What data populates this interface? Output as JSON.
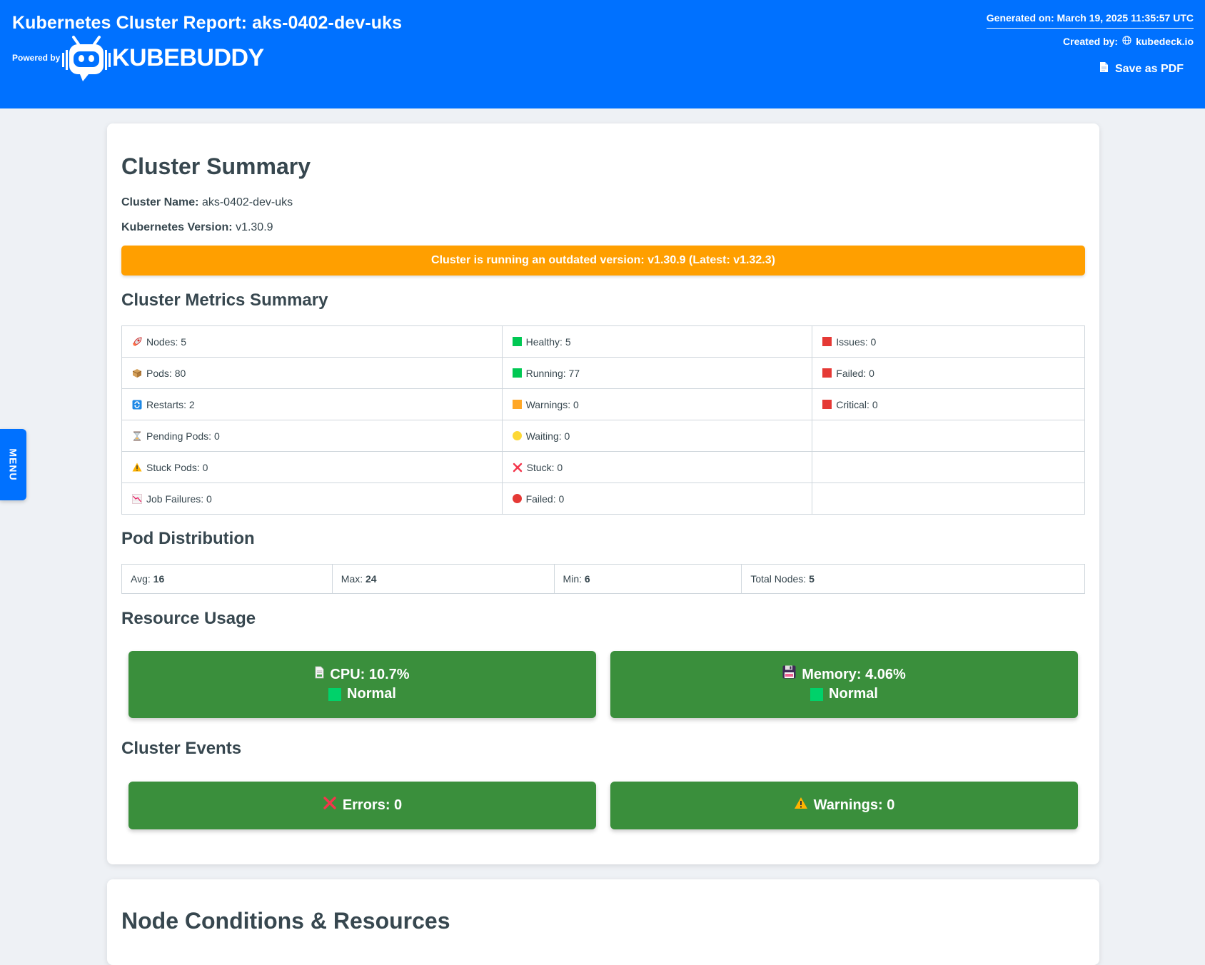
{
  "header": {
    "title": "Kubernetes Cluster Report: aks-0402-dev-uks",
    "powered_by": "Powered by",
    "logo_text": "KUBEBUDDY",
    "generated_on": "Generated on: March 19, 2025 11:35:57 UTC",
    "created_by_label": "Created by:",
    "created_by_value": "kubedeck.io",
    "save_pdf": "Save as PDF"
  },
  "menu": {
    "label": "MENU"
  },
  "summary": {
    "title": "Cluster Summary",
    "cluster_name_label": "Cluster Name:",
    "cluster_name": "aks-0402-dev-uks",
    "k8s_version_label": "Kubernetes Version:",
    "k8s_version": "v1.30.9",
    "alert": "Cluster is running an outdated version: v1.30.9 (Latest: v1.32.3)",
    "alert_color": "#ff9f00"
  },
  "metrics": {
    "title": "Cluster Metrics Summary",
    "rows": [
      {
        "a": "Nodes: 5",
        "a_icon": "rocket-icon",
        "b": "Healthy: 5",
        "b_icon": "green-square-icon",
        "c": "Issues: 0",
        "c_icon": "red-square-icon"
      },
      {
        "a": "Pods: 80",
        "a_icon": "package-icon",
        "b": "Running: 77",
        "b_icon": "green-square-icon",
        "c": "Failed: 0",
        "c_icon": "red-square-icon"
      },
      {
        "a": "Restarts: 2",
        "a_icon": "refresh-icon",
        "b": "Warnings: 0",
        "b_icon": "orange-square-icon",
        "c": "Critical: 0",
        "c_icon": "red-square-icon"
      },
      {
        "a": "Pending Pods: 0",
        "a_icon": "hourglass-icon",
        "b": "Waiting: 0",
        "b_icon": "yellow-circle-icon",
        "c": ""
      },
      {
        "a": "Stuck Pods: 0",
        "a_icon": "warning-icon",
        "b": "Stuck: 0",
        "b_icon": "cross-icon",
        "c": ""
      },
      {
        "a": "Job Failures: 0",
        "a_icon": "chart-down-icon",
        "b": "Failed: 0",
        "b_icon": "red-circle-icon",
        "c": ""
      }
    ]
  },
  "distribution": {
    "title": "Pod Distribution",
    "items": [
      {
        "label": "Avg:",
        "value": "16"
      },
      {
        "label": "Max:",
        "value": "24"
      },
      {
        "label": "Min:",
        "value": "6"
      },
      {
        "label": "Total Nodes:",
        "value": "5"
      }
    ]
  },
  "resources": {
    "title": "Resource Usage",
    "cpu": {
      "label": "CPU: 10.7%",
      "status": "Normal",
      "icon": "page-icon"
    },
    "memory": {
      "label": "Memory: 4.06%",
      "status": "Normal",
      "icon": "floppy-disk-icon"
    },
    "box_color": "#3a8f3c"
  },
  "events": {
    "title": "Cluster Events",
    "errors": "Errors: 0",
    "warnings": "Warnings: 0"
  },
  "next_section": {
    "title": "Node Conditions & Resources"
  }
}
